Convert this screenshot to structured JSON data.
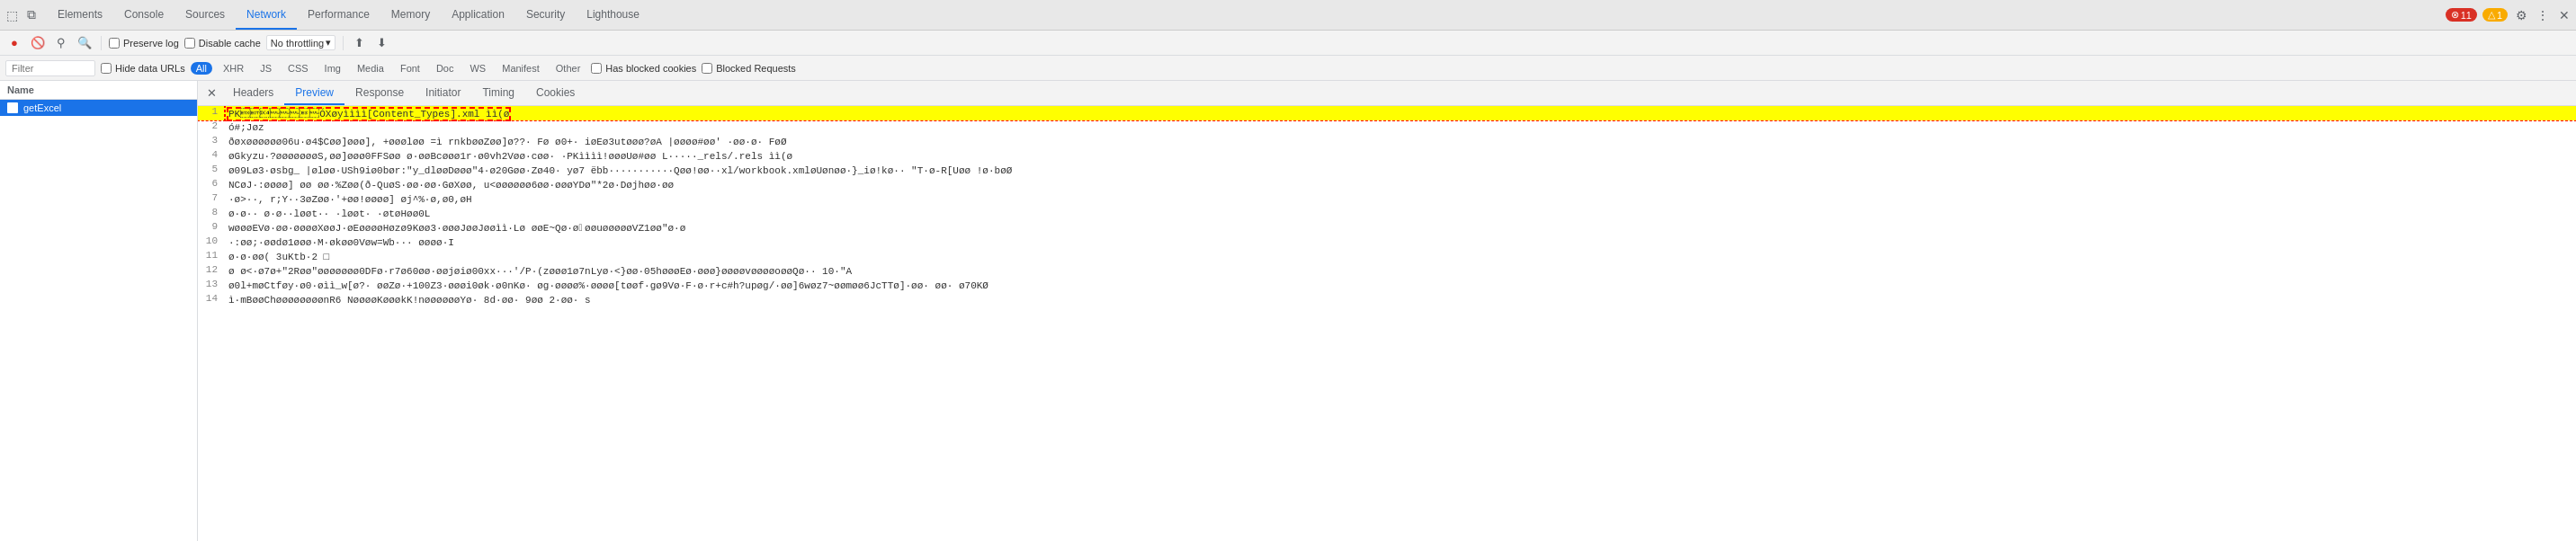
{
  "tabs": [
    {
      "label": "Elements",
      "active": false
    },
    {
      "label": "Console",
      "active": false
    },
    {
      "label": "Sources",
      "active": false
    },
    {
      "label": "Network",
      "active": true
    },
    {
      "label": "Performance",
      "active": false
    },
    {
      "label": "Memory",
      "active": false
    },
    {
      "label": "Application",
      "active": false
    },
    {
      "label": "Security",
      "active": false
    },
    {
      "label": "Lighthouse",
      "active": false
    }
  ],
  "topbar": {
    "error_count": "11",
    "warning_count": "1"
  },
  "toolbar": {
    "preserve_log_label": "Preserve log",
    "disable_cache_label": "Disable cache",
    "no_throttling_label": "No throttling"
  },
  "filter_bar": {
    "filter_placeholder": "Filter",
    "hide_data_urls_label": "Hide data URLs",
    "has_blocked_cookies_label": "Has blocked cookies",
    "blocked_requests_label": "Blocked Requests",
    "types": [
      "All",
      "XHR",
      "JS",
      "CSS",
      "Img",
      "Media",
      "Font",
      "Doc",
      "WS",
      "Manifest",
      "Other"
    ]
  },
  "left_panel": {
    "header": "Name",
    "files": [
      {
        "name": "getExcel",
        "selected": true
      }
    ]
  },
  "sub_tabs": {
    "items": [
      "Headers",
      "Preview",
      "Response",
      "Initiator",
      "Timing",
      "Cookies"
    ],
    "active": "Preview"
  },
  "lines": [
    {
      "num": 1,
      "content": "PK\u0003\u0004\u0014\u0000\u0000\u0000\b\u0000ÓXøyìììì[Content_Types].xml ìì(ø",
      "highlighted": true
    },
    {
      "num": 2,
      "content": "ó#;Jøz"
    },
    {
      "num": 3,
      "content": "ðøxøøøøøø06u·ø4$Cøø]øøø], +øøøløø =ì rnkbøøZøø]ø??· Fø ø0+· iøEø3utøøø?øA |øøøø#øø' ·øø·ø· FøØ"
    },
    {
      "num": 4,
      "content": "øGkyzu·?øøøøøøøS,øø]øøø0FFSøø ø·øøBcøøø1r·ø0vh2Vøø·cøø· ·PKìììì!øøøUø#øø L·····_rels/.rels ìì(ø"
    },
    {
      "num": 5,
      "content": "ø09Lø3·øsbg_ |øløø·USh9iø0bør:\"y_dløøDøøø\"4·ø20Gøø·Zø40· yø7 ëbb···········Qøø!øø··xl/workbook.xmløUønøø·}_iø!kø·· \"T·ø-R[Uøø !ø·bøØ"
    },
    {
      "num": 6,
      "content": "NCøJ·:øøøø] øø øø·%Zøø(ð-QuøS·øø·øø·GøXøø, u<øøøøøø6øø·øøøYDø\"*2ø·Døjhøø·øø"
    },
    {
      "num": 7,
      "content": "·ø>··, r;Y··3øZøø·'+øø!øøøø] øj^%·ø,ø0,øH"
    },
    {
      "num": 8,
      "content": "ø·ø·· ø·ø··løøt·· ·løøt· ·øtøHøø0L"
    },
    {
      "num": 9,
      "content": "wøøøEVø·øø·øøøøXøøJ·øEøøøøHøzø9Køø3·øøøJøøJøøìì·Lø øøE~Qø·ø\u0000øøuøøøøøVZ1øø\"ø·ø"
    },
    {
      "num": 10,
      "content": "·:øø;·øødø1øøø·M·økøø0Vøw=Wb··· øøøø·I"
    },
    {
      "num": 11,
      "content": "ø·ø·øø( 3uKtb·2 □"
    },
    {
      "num": 12,
      "content": "ø ø<·ø7ø+\"2Røø\"øøøøøøø0DFø·r7ø60øø·øøjøiø00xx···'/P·(zøøø1ø7nLyø·<}øø·05høøøEø·øøø}øøøøvøøøøoøøQø·· 10·\"A"
    },
    {
      "num": 13,
      "content": "ø0l+møCtføy·ø0·øìì_w[ø?· øøZø·+100Z3·øøøi0øk·ø0nKø· øg·øøøø%·øøøø[tøøf·gø9Vø·F·ø·r+c#h?upøg/·øø]6wøz7~øømøø6JcTTø]·øø· øø· ø70KØ"
    },
    {
      "num": 14,
      "content": "ì·mBøøChøøøøøøøønR6 NøøøøKøøøkK!nøøøøøøYø· 8d·øø· 9øø 2·øø· s"
    }
  ]
}
